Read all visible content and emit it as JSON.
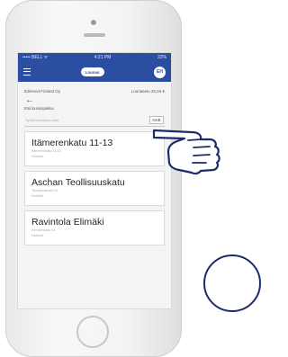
{
  "status_bar": {
    "carrier": "••••• BELL ᯤ",
    "time": "4:21 PM",
    "battery": "22%"
  },
  "app_bar": {
    "logo_text": "Lounas",
    "avatar_initials": "EH"
  },
  "header": {
    "company": "Edenred Finland Oy",
    "balance": "Lounasetu 32,04 €"
  },
  "back_glyph": "←",
  "section_label": "Etsi lounaspaikka",
  "search": {
    "placeholder": "Syötä ravintolan nimi",
    "button_label": "HAE"
  },
  "restaurants": [
    {
      "name": "Itämerenkatu 11-13",
      "address": "Itämerenkatu 11-13",
      "city": "Helsinki"
    },
    {
      "name": "Aschan Teollisuuskatu",
      "address": "Teollisuuskatu 21",
      "city": "Helsinki"
    },
    {
      "name": "Ravintola Elimäki",
      "address": "Elimäenkatu 14",
      "city": "Helsinki"
    }
  ]
}
